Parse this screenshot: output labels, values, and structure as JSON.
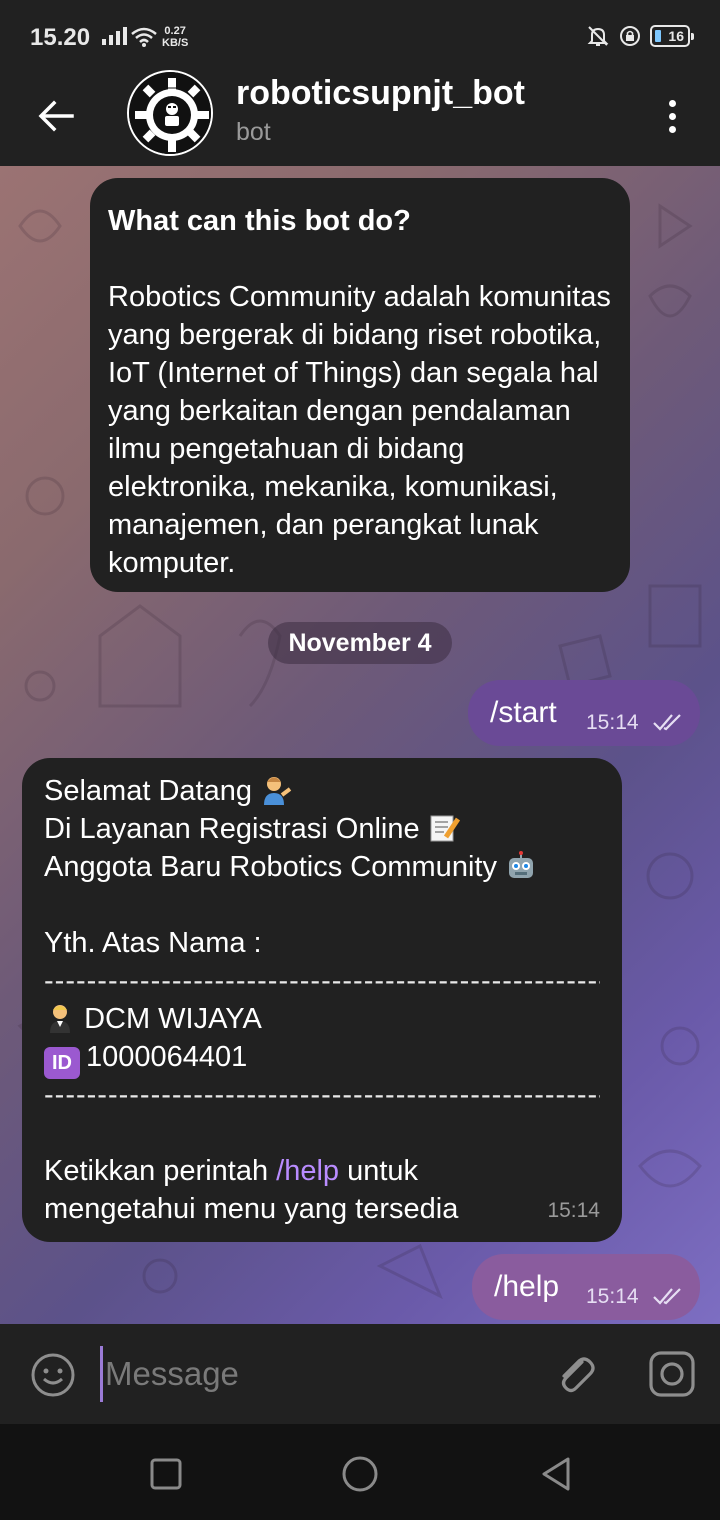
{
  "status_bar": {
    "time": "15.20",
    "speed_value": "0.27",
    "speed_unit": "KB/S",
    "battery": "16"
  },
  "header": {
    "title": "roboticsupnjt_bot",
    "subtitle": "bot"
  },
  "intro": {
    "title": "What can this bot do?",
    "body": "Robotics Community adalah komunitas yang bergerak di bidang riset robotika, IoT (Internet of Things) dan segala hal yang berkaitan dengan pendalaman ilmu pengetahuan di bidang elektronika, mekanika, komunikasi, manajemen, dan perangkat lunak komputer."
  },
  "date_separator": "November 4",
  "messages": {
    "start": {
      "text": "/start",
      "time": "15:14"
    },
    "welcome": {
      "line1": "Selamat Datang",
      "line2": "Di Layanan Registrasi Online",
      "line3": "Anggota Baru Robotics Community",
      "greeting": "Yth. Atas Nama :",
      "divider": "--------------------------------------------------------------",
      "name": "DCM WIJAYA",
      "id_number": "1000064401",
      "footer_prefix": "Ketikkan perintah",
      "footer_command": "/help",
      "footer_suffix": "untuk",
      "footer_line2": "mengetahui menu yang tersedia",
      "time": "15:14"
    },
    "help": {
      "text": "/help",
      "time": "15:14"
    }
  },
  "input": {
    "placeholder": "Message"
  },
  "colors": {
    "header_bg": "#212121",
    "bubble_in": "#212121",
    "bubble_out": "#6a4a96",
    "command": "#b98cff"
  },
  "icons": [
    "back-arrow-icon",
    "more-vertical-icon",
    "emoji-icon",
    "attach-icon",
    "camera-icon",
    "read-ticks-icon",
    "id-emoji-icon",
    "robot-emoji-icon",
    "memo-emoji-icon",
    "person-emoji-icon"
  ]
}
